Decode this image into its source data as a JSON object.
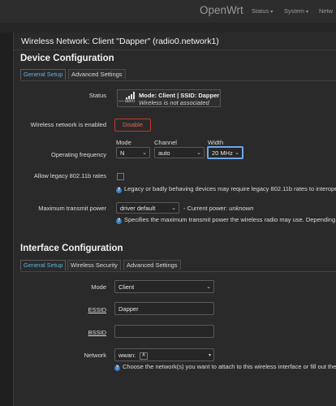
{
  "topbar": {
    "brand": "OpenWrt",
    "nav": [
      "Status",
      "System",
      "Netw"
    ]
  },
  "modal": {
    "title": "Wireless Network: Client \"Dapper\" (radio0.network1)"
  },
  "device_config": {
    "heading": "Device Configuration",
    "tabs": [
      "General Setup",
      "Advanced Settings"
    ],
    "status_label": "Status",
    "status": {
      "dbm": "— dBm",
      "mode_ssid": "Mode: Client | SSID: Dapper",
      "assoc": "Wireless is not associated"
    },
    "enabled_label": "Wireless network is enabled",
    "disable_btn": "Disable",
    "freq_label": "Operating frequency",
    "mode_label": "Mode",
    "channel_label": "Channel",
    "width_label": "Width",
    "mode_value": "N",
    "channel_value": "auto",
    "width_value": "20 MHz",
    "legacy_label": "Allow legacy 802.11b rates",
    "legacy_help": "Legacy or badly behaving devices may require legacy 802.11b rates to interope",
    "txpower_label": "Maximum transmit power",
    "txpower_value": "driver default",
    "current_power_prefix": "- Current power:",
    "current_power_value": "unknown",
    "txpower_help": "Specifies the maximum transmit power the wireless radio may use. Depending"
  },
  "iface_config": {
    "heading": "Interface Configuration",
    "tabs": [
      "General Setup",
      "Wireless Security",
      "Advanced Settings"
    ],
    "mode_label": "Mode",
    "mode_value": "Client",
    "essid_label": "ESSID",
    "essid_value": "Dapper",
    "bssid_label": "BSSID",
    "bssid_value": "",
    "network_label": "Network",
    "network_value": "wwan:",
    "network_help": "Choose the network(s) you want to attach to this wireless interface or fill out the"
  }
}
